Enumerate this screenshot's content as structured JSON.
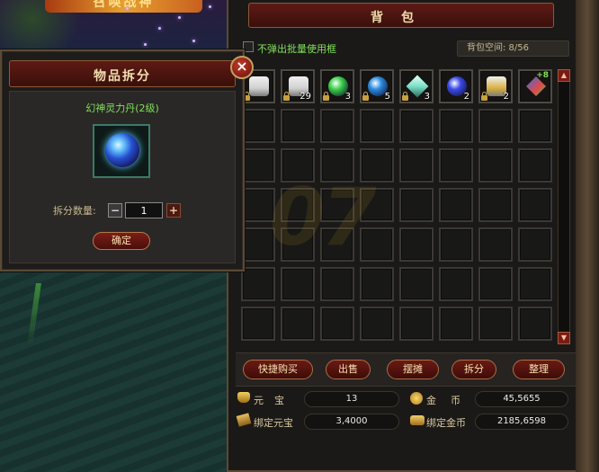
{
  "scene": {
    "banner_text": "召唤战神"
  },
  "split_window": {
    "title": "物品拆分",
    "close_label": "×",
    "item_name": "幻神灵力丹(2级)",
    "quantity_label": "拆分数量:",
    "quantity_value": "1",
    "minus_label": "−",
    "plus_label": "+",
    "confirm_label": "确定"
  },
  "bag": {
    "title": "背包",
    "no_popup_label": "不弹出批量使用框",
    "space_label": "背包空间: 8/56",
    "scroll_up": "▲",
    "scroll_down": "▼",
    "watermark": "07",
    "items": [
      {
        "icon": "scroll-icon",
        "count": "",
        "locked": true,
        "color": "#d0d0d0"
      },
      {
        "icon": "scroll-icon",
        "count": "29",
        "locked": true,
        "color": "#d0d0d0"
      },
      {
        "icon": "green-orb-icon",
        "count": "3",
        "locked": true,
        "color": "#3ad04a"
      },
      {
        "icon": "blue-orb-icon",
        "count": "5",
        "locked": true,
        "color": "#2a8ae0"
      },
      {
        "icon": "crystal-icon",
        "count": "3",
        "locked": true,
        "color": "#7ae0c8"
      },
      {
        "icon": "purple-orb-icon",
        "count": "2",
        "locked": false,
        "color": "#3a4ae8"
      },
      {
        "icon": "gold-scroll-icon",
        "count": "2",
        "locked": true,
        "color": "#d8b040"
      },
      {
        "icon": "upgrade-gem-icon",
        "count": "",
        "locked": false,
        "color": "#e04a4a",
        "plus": "+8"
      }
    ],
    "actions": [
      "快捷购买",
      "出售",
      "摆摊",
      "拆分",
      "整理"
    ],
    "currency": {
      "yuanbao_label": "元宝",
      "yuanbao_value": "13",
      "gold_label": "金币",
      "gold_value": "45,5655",
      "bound_yuanbao_label": "绑定元宝",
      "bound_yuanbao_value": "3,4000",
      "bound_gold_label": "绑定金币",
      "bound_gold_value": "2185,6598"
    }
  }
}
